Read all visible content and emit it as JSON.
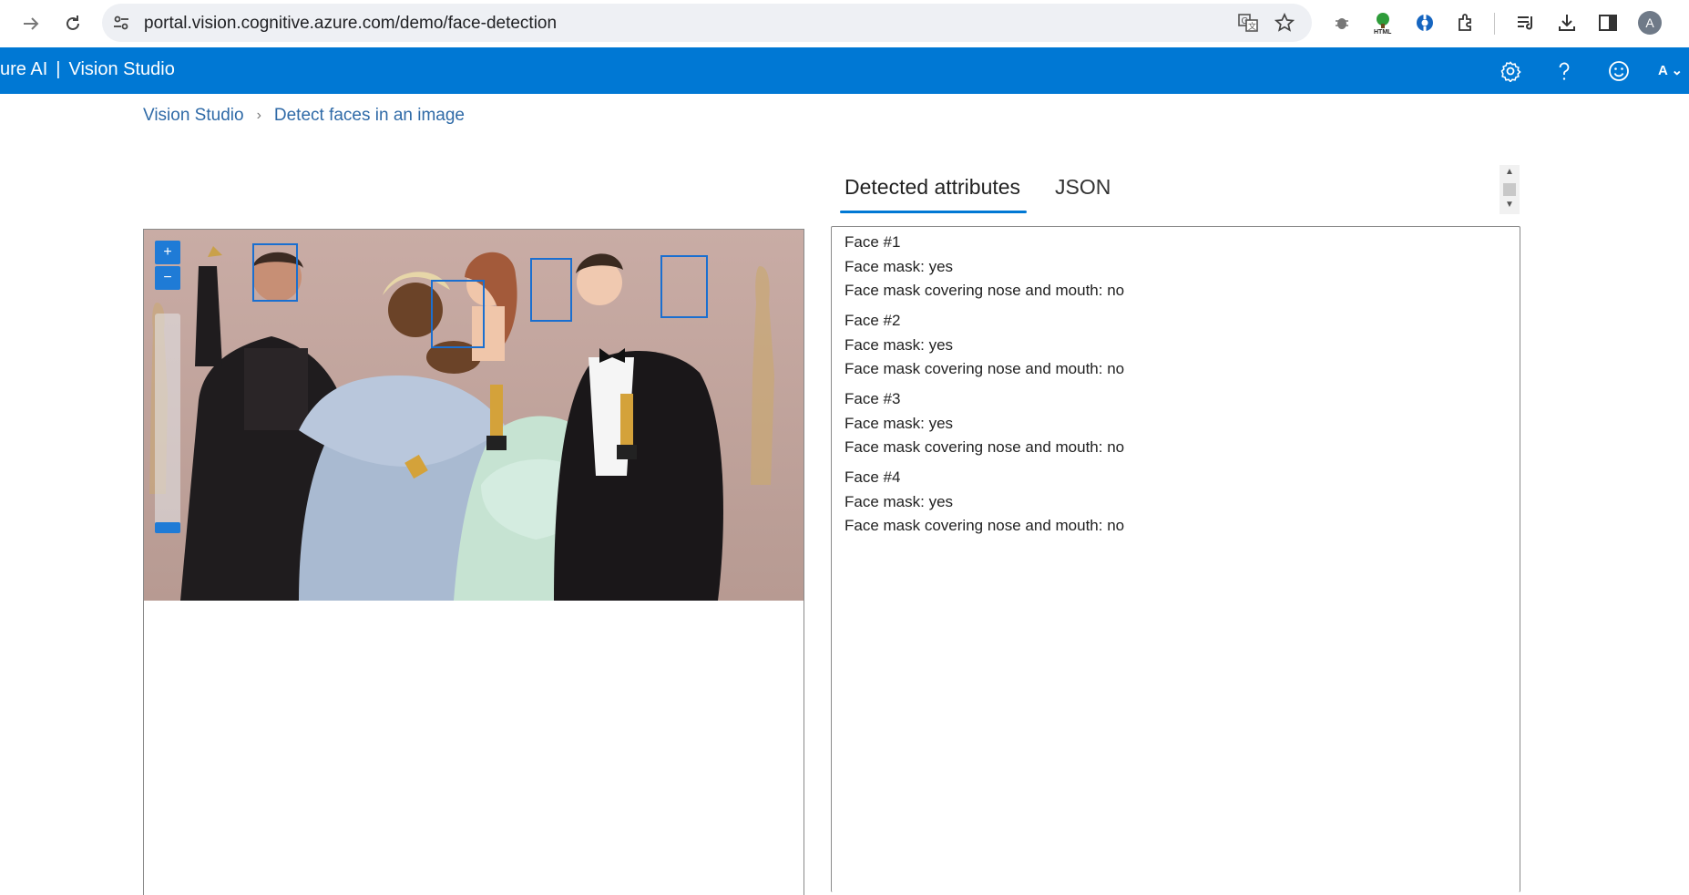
{
  "browser": {
    "url": "portal.vision.cognitive.azure.com/demo/face-detection",
    "profile_initial": "A",
    "icons": [
      "forward-arrow-icon",
      "reload-icon",
      "site-info-icon",
      "translate-icon",
      "bookmark-star-icon",
      "bug-extension-icon",
      "html-extension-icon",
      "extension-icon",
      "extensions-puzzle-icon",
      "reading-list-icon",
      "download-icon",
      "side-panel-icon"
    ]
  },
  "header": {
    "brand": "ure AI",
    "separator": "|",
    "product": "Vision Studio",
    "user_initial": "A",
    "icons": [
      "settings-icon",
      "help-icon",
      "feedback-smiley-icon"
    ],
    "background": "#0078d4"
  },
  "breadcrumb": {
    "items": [
      "Vision Studio",
      "Detect faces in an image"
    ]
  },
  "tabs": [
    {
      "label": "Detected attributes",
      "active": true
    },
    {
      "label": "JSON",
      "active": false
    }
  ],
  "image_viewer": {
    "zoom_in": "+",
    "zoom_out": "−",
    "zoom_level": 0.0,
    "faces_detected": 4
  },
  "results": {
    "faces": [
      {
        "title": "Face #1",
        "mask": "Face mask: yes",
        "covering": "Face mask covering nose and mouth: no"
      },
      {
        "title": "Face #2",
        "mask": "Face mask: yes",
        "covering": "Face mask covering nose and mouth: no"
      },
      {
        "title": "Face #3",
        "mask": "Face mask: yes",
        "covering": "Face mask covering nose and mouth: no"
      },
      {
        "title": "Face #4",
        "mask": "Face mask: yes",
        "covering": "Face mask covering nose and mouth: no"
      }
    ]
  },
  "colors": {
    "accent": "#0078d4",
    "face_box": "#1a6fd0",
    "link": "#2f6aa7"
  }
}
